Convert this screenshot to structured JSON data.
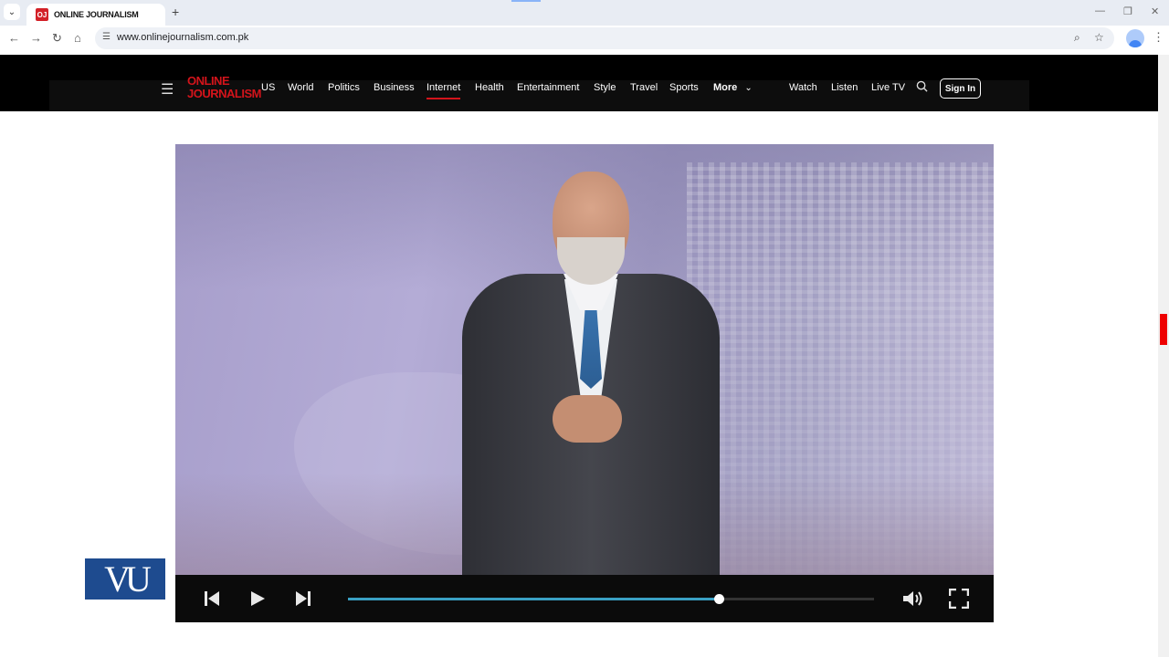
{
  "browser": {
    "tab_title": "ONLINE JOURNALISM",
    "favicon_text": "OJ",
    "url": "www.onlinejournalism.com.pk"
  },
  "site": {
    "logo_line1": "ONLINE",
    "logo_line2": "JOURNALISM",
    "nav": [
      "US",
      "World",
      "Politics",
      "Business",
      "Internet",
      "Health",
      "Entertainment",
      "Style",
      "Travel",
      "Sports",
      "More"
    ],
    "active_nav": "Internet",
    "right_nav": [
      "Watch",
      "Listen",
      "Live TV"
    ],
    "signin_label": "Sign In"
  },
  "player": {
    "progress_fraction": 0.705
  },
  "branding": {
    "vu_logo_text": "VU"
  },
  "colors": {
    "brand_red": "#d3141b",
    "progress_blue": "#3aa0c4",
    "vu_blue": "#1e4b8f"
  }
}
